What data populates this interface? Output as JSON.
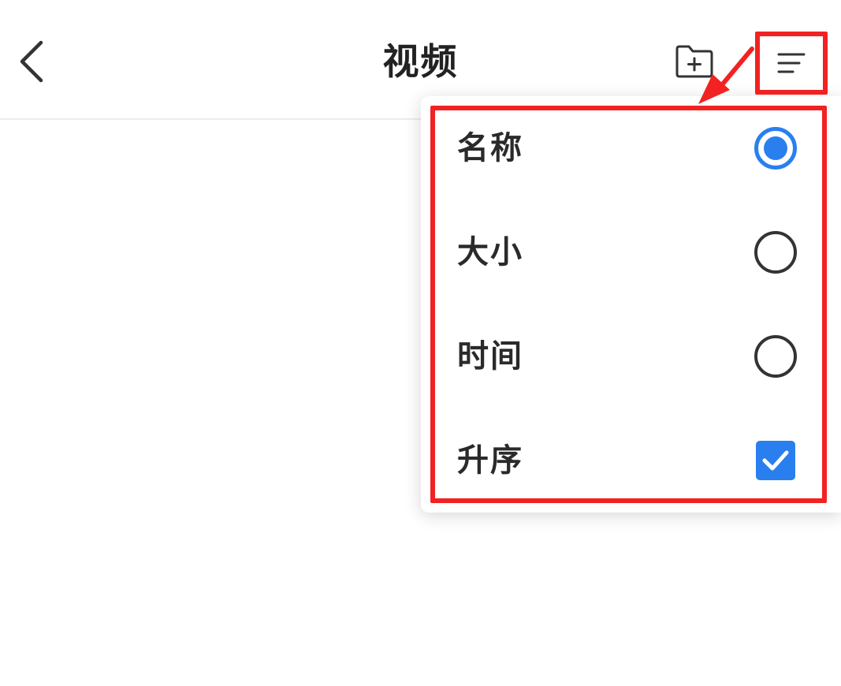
{
  "header": {
    "title": "视频",
    "back_icon": "chevron-left-icon",
    "new_folder_icon": "folder-plus-icon",
    "sort_icon": "sort-lines-icon"
  },
  "sort_menu": {
    "items": [
      {
        "label": "名称",
        "control": "radio",
        "checked": true
      },
      {
        "label": "大小",
        "control": "radio",
        "checked": false
      },
      {
        "label": "时间",
        "control": "radio",
        "checked": false
      },
      {
        "label": "升序",
        "control": "checkbox",
        "checked": true
      }
    ]
  },
  "colors": {
    "accent": "#2a7fef",
    "highlight": "#f22222",
    "text": "#222222"
  }
}
